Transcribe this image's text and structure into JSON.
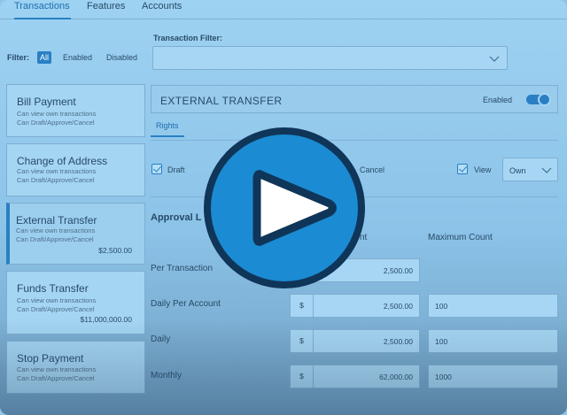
{
  "tabs": [
    "Transactions",
    "Features",
    "Accounts"
  ],
  "filter": {
    "label": "Filter:",
    "options": [
      "All",
      "Enabled",
      "Disabled"
    ],
    "selected": "All"
  },
  "transaction_filter": {
    "label": "Transaction Filter:",
    "value": ""
  },
  "cards": [
    {
      "title": "Bill Payment",
      "lines": [
        "Can view own transactions",
        "Can Draft/Approve/Cancel"
      ],
      "amount": ""
    },
    {
      "title": "Change of Address",
      "lines": [
        "Can view own transactions",
        "Can Draft/Approve/Cancel"
      ],
      "amount": ""
    },
    {
      "title": "External Transfer",
      "lines": [
        "Can view own transactions",
        "Can Draft/Approve/Cancel"
      ],
      "amount": "$2,500.00"
    },
    {
      "title": "Funds Transfer",
      "lines": [
        "Can view own transactions",
        "Can Draft/Approve/Cancel"
      ],
      "amount": "$11,000,000.00"
    },
    {
      "title": "Stop Payment",
      "lines": [
        "Can view own transactions",
        "Can Draft/Approve/Cancel"
      ],
      "amount": ""
    }
  ],
  "panel": {
    "title": "EXTERNAL TRANSFER",
    "status": "Enabled"
  },
  "subtab": "Rights",
  "rights": {
    "draft": "Draft",
    "cancel": "Cancel",
    "view": "View",
    "view_scope": "Own"
  },
  "approval": {
    "title": "Approval L",
    "amount_header": "nt",
    "count_header": "Maximum Count"
  },
  "limits": [
    {
      "label": "Per Transaction",
      "currency": "",
      "amount": "2,500.00",
      "count": ""
    },
    {
      "label": "Daily Per Account",
      "currency": "$",
      "amount": "2,500.00",
      "count": "100"
    },
    {
      "label": "Daily",
      "currency": "$",
      "amount": "2,500.00",
      "count": "100"
    },
    {
      "label": "Monthly",
      "currency": "$",
      "amount": "62,000.00",
      "count": "1000"
    }
  ],
  "colors": {
    "accent": "#2a7fc4",
    "play": "#1b8bd3",
    "play_ring": "#0f3559"
  }
}
